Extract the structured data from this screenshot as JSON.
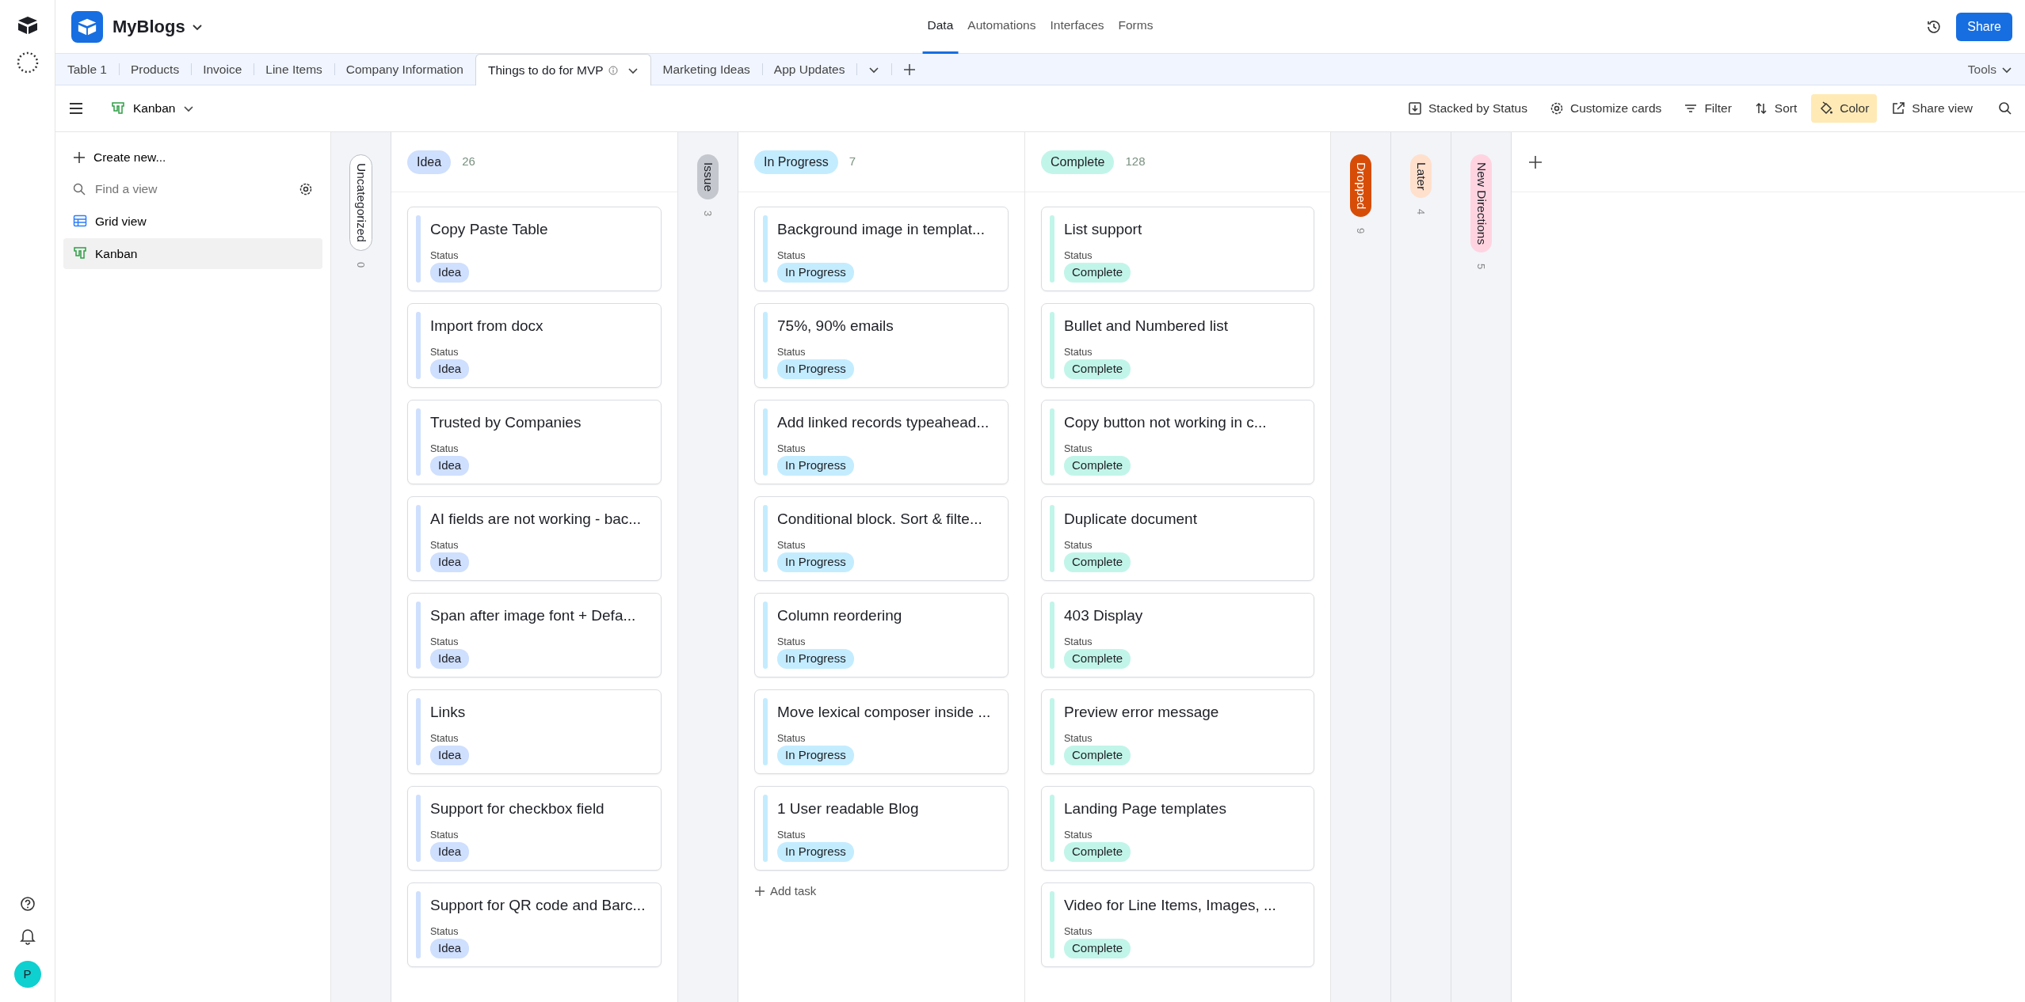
{
  "rail": {
    "avatar": "P"
  },
  "base": {
    "name": "MyBlogs"
  },
  "top_nav": [
    {
      "label": "Data",
      "selected": true
    },
    {
      "label": "Automations",
      "selected": false
    },
    {
      "label": "Interfaces",
      "selected": false
    },
    {
      "label": "Forms",
      "selected": false
    }
  ],
  "share_button": "Share",
  "tabs": [
    {
      "label": "Table 1",
      "selected": false
    },
    {
      "label": "Products",
      "selected": false
    },
    {
      "label": "Invoice",
      "selected": false
    },
    {
      "label": "Line Items",
      "selected": false
    },
    {
      "label": "Company Information",
      "selected": false
    },
    {
      "label": "Things to do for MVP",
      "selected": true
    },
    {
      "label": "Marketing Ideas",
      "selected": false
    },
    {
      "label": "App Updates",
      "selected": false
    }
  ],
  "tools": "Tools",
  "view_switcher": "Kanban",
  "toolbar": [
    {
      "kind": "stack",
      "label": "Stacked by Status",
      "on": false
    },
    {
      "kind": "customize",
      "label": "Customize cards",
      "on": false
    },
    {
      "kind": "filter",
      "label": "Filter",
      "on": false
    },
    {
      "kind": "sort",
      "label": "Sort",
      "on": false
    },
    {
      "kind": "color",
      "label": "Color",
      "on": true
    },
    {
      "kind": "share",
      "label": "Share view",
      "on": false
    }
  ],
  "sidebar": {
    "create": "Create new...",
    "search": {
      "placeholder": "Find a view"
    },
    "items": [
      {
        "kind": "grid",
        "label": "Grid view",
        "selected": false
      },
      {
        "kind": "kanban",
        "label": "Kanban",
        "selected": true
      }
    ]
  },
  "columns": [
    {
      "kind": "collapsed",
      "name": "Uncategorized",
      "count": "0",
      "color": "#ffffff"
    },
    {
      "kind": "expanded",
      "name": "Idea",
      "count": "26",
      "color": "#cfdffe",
      "cards": [
        {
          "title": "Copy Paste Table",
          "field": "Status",
          "status": "Idea"
        },
        {
          "title": "Import from docx",
          "field": "Status",
          "status": "Idea"
        },
        {
          "title": "Trusted by Companies",
          "field": "Status",
          "status": "Idea"
        },
        {
          "title": "AI fields are not working - bac...",
          "field": "Status",
          "status": "Idea"
        },
        {
          "title": "Span after image font + Defa...",
          "field": "Status",
          "status": "Idea"
        },
        {
          "title": "Links",
          "field": "Status",
          "status": "Idea"
        },
        {
          "title": "Support for checkbox field",
          "field": "Status",
          "status": "Idea"
        },
        {
          "title": "Support for QR code and Barc...",
          "field": "Status",
          "status": "Idea"
        }
      ]
    },
    {
      "kind": "collapsed",
      "name": "Issue",
      "count": "3",
      "color": "#c4c7cd"
    },
    {
      "kind": "expanded",
      "name": "In Progress",
      "count": "7",
      "color": "#c4ecff",
      "add": "Add task",
      "cards": [
        {
          "title": "Background image in templat...",
          "field": "Status",
          "status": "In Progress"
        },
        {
          "title": "75%, 90% emails",
          "field": "Status",
          "status": "In Progress"
        },
        {
          "title": "Add linked records typeahead...",
          "field": "Status",
          "status": "In Progress"
        },
        {
          "title": "Conditional block. Sort & filte...",
          "field": "Status",
          "status": "In Progress"
        },
        {
          "title": "Column reordering",
          "field": "Status",
          "status": "In Progress"
        },
        {
          "title": "Move lexical composer inside ...",
          "field": "Status",
          "status": "In Progress"
        },
        {
          "title": "1 User readable Blog",
          "field": "Status",
          "status": "In Progress"
        }
      ]
    },
    {
      "kind": "expanded",
      "name": "Complete",
      "count": "128",
      "color": "#c2f5e9",
      "cards": [
        {
          "title": "List support",
          "field": "Status",
          "status": "Complete"
        },
        {
          "title": "Bullet and Numbered list",
          "field": "Status",
          "status": "Complete"
        },
        {
          "title": "Copy button not working in c...",
          "field": "Status",
          "status": "Complete"
        },
        {
          "title": "Duplicate document",
          "field": "Status",
          "status": "Complete"
        },
        {
          "title": "403 Display",
          "field": "Status",
          "status": "Complete"
        },
        {
          "title": "Preview error message",
          "field": "Status",
          "status": "Complete"
        },
        {
          "title": "Landing Page templates",
          "field": "Status",
          "status": "Complete"
        },
        {
          "title": "Video for Line Items, Images, ...",
          "field": "Status",
          "status": "Complete"
        }
      ]
    },
    {
      "kind": "collapsed",
      "name": "Dropped",
      "count": "9",
      "color": "#d74d07"
    },
    {
      "kind": "collapsed",
      "name": "Later",
      "count": "4",
      "color": "#ffe0cc"
    },
    {
      "kind": "collapsed",
      "name": "New Directions",
      "count": "5",
      "color": "#ffd4e0"
    }
  ]
}
